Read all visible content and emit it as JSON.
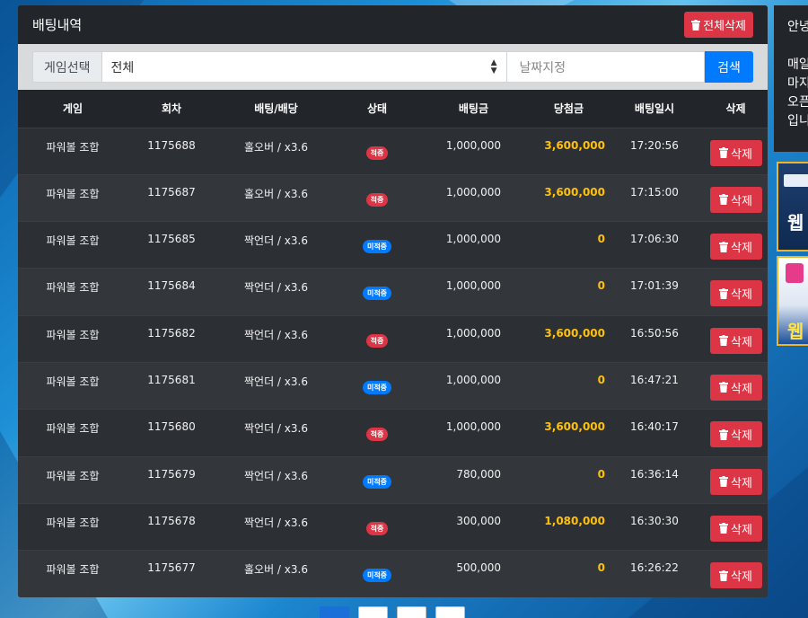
{
  "panel": {
    "title": "배팅내역",
    "delete_all_label": "전체삭제"
  },
  "filter": {
    "game_label": "게임선택",
    "game_selected": "전체",
    "date_placeholder": "날짜지정",
    "search_label": "검색"
  },
  "table": {
    "headers": [
      "게임",
      "회차",
      "배팅/배당",
      "상태",
      "배팅금",
      "당첨금",
      "배팅일시",
      "삭제"
    ],
    "delete_label": "삭제",
    "rows": [
      {
        "game": "파워볼 조합",
        "round": "1175688",
        "bet": "홀오버 / x3.6",
        "status": "적중",
        "status_type": "hit",
        "amount": "1,000,000",
        "win": "3,600,000",
        "time": "17:20:56"
      },
      {
        "game": "파워볼 조합",
        "round": "1175687",
        "bet": "홀오버 / x3.6",
        "status": "적중",
        "status_type": "hit",
        "amount": "1,000,000",
        "win": "3,600,000",
        "time": "17:15:00"
      },
      {
        "game": "파워볼 조합",
        "round": "1175685",
        "bet": "짝언더 / x3.6",
        "status": "미적중",
        "status_type": "miss",
        "amount": "1,000,000",
        "win": "0",
        "time": "17:06:30"
      },
      {
        "game": "파워볼 조합",
        "round": "1175684",
        "bet": "짝언더 / x3.6",
        "status": "미적중",
        "status_type": "miss",
        "amount": "1,000,000",
        "win": "0",
        "time": "17:01:39"
      },
      {
        "game": "파워볼 조합",
        "round": "1175682",
        "bet": "짝언더 / x3.6",
        "status": "적중",
        "status_type": "hit",
        "amount": "1,000,000",
        "win": "3,600,000",
        "time": "16:50:56"
      },
      {
        "game": "파워볼 조합",
        "round": "1175681",
        "bet": "짝언더 / x3.6",
        "status": "미적중",
        "status_type": "miss",
        "amount": "1,000,000",
        "win": "0",
        "time": "16:47:21"
      },
      {
        "game": "파워볼 조합",
        "round": "1175680",
        "bet": "짝언더 / x3.6",
        "status": "적중",
        "status_type": "hit",
        "amount": "1,000,000",
        "win": "3,600,000",
        "time": "16:40:17"
      },
      {
        "game": "파워볼 조합",
        "round": "1175679",
        "bet": "짝언더 / x3.6",
        "status": "미적중",
        "status_type": "miss",
        "amount": "780,000",
        "win": "0",
        "time": "16:36:14"
      },
      {
        "game": "파워볼 조합",
        "round": "1175678",
        "bet": "짝언더 / x3.6",
        "status": "적중",
        "status_type": "hit",
        "amount": "300,000",
        "win": "1,080,000",
        "time": "16:30:30"
      },
      {
        "game": "파워볼 조합",
        "round": "1175677",
        "bet": "홀오버 / x3.6",
        "status": "미적중",
        "status_type": "miss",
        "amount": "500,000",
        "win": "0",
        "time": "16:26:22"
      }
    ]
  },
  "side": {
    "lines": [
      "안녕",
      "매일",
      "마지",
      "오픈",
      "입니"
    ],
    "banner1_text": "웹",
    "banner2_text": "웹"
  },
  "colors": {
    "win": "#ffc107",
    "hit_badge": "#dc3545",
    "miss_badge": "#007bff",
    "danger": "#dc3545",
    "primary": "#007bff"
  },
  "icons": {
    "delete": "trash-icon",
    "select": "chevron-updown-icon"
  }
}
